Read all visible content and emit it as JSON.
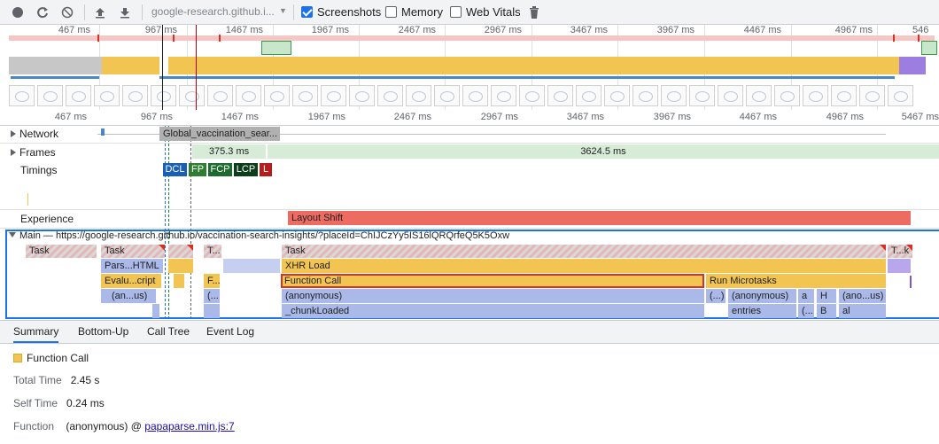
{
  "toolbar": {
    "url_select": "google-research.github.i...",
    "screenshots_label": "Screenshots",
    "memory_label": "Memory",
    "web_vitals_label": "Web Vitals",
    "screenshots_checked": true,
    "memory_checked": false,
    "web_vitals_checked": false
  },
  "overview": {
    "ticks": [
      "467 ms",
      "967 ms",
      "1467 ms",
      "1967 ms",
      "2467 ms",
      "2967 ms",
      "3467 ms",
      "3967 ms",
      "4467 ms",
      "4967 ms",
      "546"
    ]
  },
  "ruler": {
    "ticks": [
      "467 ms",
      "967 ms",
      "1467 ms",
      "1967 ms",
      "2467 ms",
      "2967 ms",
      "3467 ms",
      "3967 ms",
      "4467 ms",
      "4967 ms",
      "5467 ms"
    ]
  },
  "tracks": {
    "network_label": "Network",
    "network_request": "Global_vaccination_sear...",
    "frames_label": "Frames",
    "frame_1": "375.3 ms",
    "frame_2": "3624.5 ms",
    "timings_label": "Timings",
    "timings": [
      "DCL",
      "FP",
      "FCP",
      "LCP",
      "L"
    ],
    "experience_label": "Experience",
    "layout_shift": "Layout Shift",
    "main_label": "Main — https://google-research.github.io/vaccination-search-insights/?placeId=ChIJCzYy5IS16lQRQrfeQ5K5Oxw"
  },
  "flame": {
    "row0": [
      "Task",
      "Task",
      "T...",
      "Task",
      "T...k"
    ],
    "row1": [
      "Pars...HTML",
      "XHR Load"
    ],
    "row2": [
      "Evalu...cript",
      "F...",
      "Function Call",
      "Run Microtasks"
    ],
    "row3": [
      "(an...us)",
      "(...",
      "(anonymous)",
      "(...)",
      "(anonymous)",
      "a",
      "H",
      "(ano...us)"
    ],
    "row4": [
      "_chunkLoaded",
      "entries",
      "(...",
      "B",
      "al"
    ]
  },
  "bottom_tabs": [
    "Summary",
    "Bottom-Up",
    "Call Tree",
    "Event Log"
  ],
  "summary": {
    "title": "Function Call",
    "total_time_key": "Total Time",
    "total_time_val": "2.45 s",
    "self_time_key": "Self Time",
    "self_time_val": "0.24 ms",
    "function_key": "Function",
    "function_val": "(anonymous) @",
    "function_link": "papaparse.min.js:7",
    "swatch_color": "#f2c451"
  }
}
